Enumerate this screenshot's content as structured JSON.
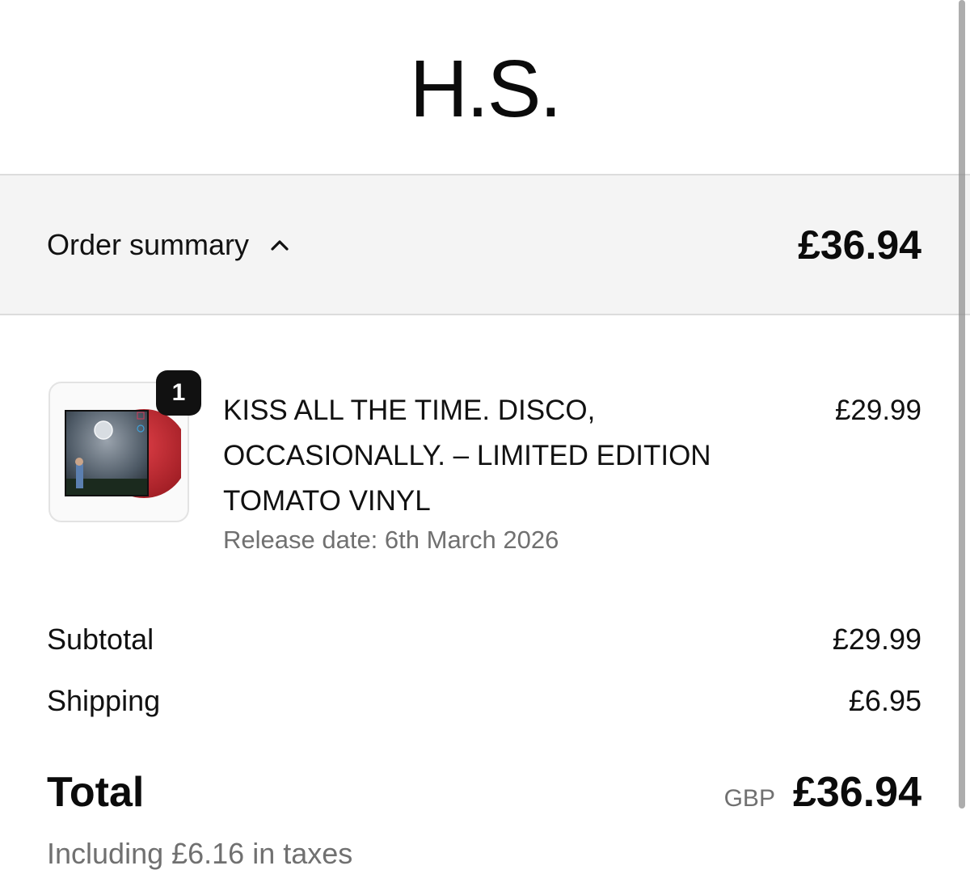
{
  "brand": {
    "logo_text": "H.S."
  },
  "summary_bar": {
    "label": "Order summary",
    "toggle_icon": "chevron-up-icon",
    "total": "£36.94"
  },
  "line_item": {
    "quantity": "1",
    "title": "KISS ALL THE TIME. DISCO, OCCASIONALLY. – LIMITED EDITION TOMATO VINYL",
    "release_date": "Release date: 6th March 2026",
    "price": "£29.99",
    "vinyl_color": "#c0252b"
  },
  "totals": {
    "subtotal_label": "Subtotal",
    "subtotal_value": "£29.99",
    "shipping_label": "Shipping",
    "shipping_value": "£6.95",
    "total_label": "Total",
    "currency": "GBP",
    "total_value": "£36.94",
    "taxes_note": "Including £6.16 in taxes"
  }
}
